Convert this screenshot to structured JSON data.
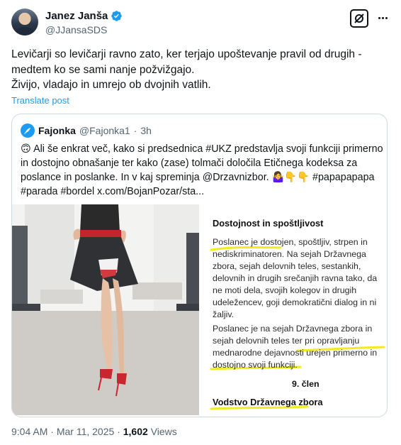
{
  "author": {
    "name": "Janez Janša",
    "handle": "@JJansaSDS"
  },
  "tweet": {
    "lines": [
      "Levičarji so levičarji ravno zato, ker terjajo upoštevanje pravil od drugih -",
      "medtem ko se sami nanje požvižgajo.",
      "Živijo, vladajo in umrejo ob dvojnih vatlih."
    ],
    "translate_label": "Translate post"
  },
  "quote": {
    "name": "Fajonka",
    "handle": "@Fajonka1",
    "separator": "·",
    "time": "3h",
    "lines": [
      "🙃 Ali še enkrat več, kako si predsednica #UKZ predstavlja svoji funkciji primerno",
      "in dostojno obnašanje ter kako (zase) tolmači določila Etičnega kodeksa za",
      "poslance in poslanke. In v kaj spreminja @Drzavnizbor. 🤷‍♀️👇👇 #papapapapa",
      "#parada #bordel  x.com/BojanPozar/sta..."
    ],
    "document": {
      "title": "Dostojnost in spoštljivost",
      "paragraph1": [
        "Poslanec je dostojen, spoštljiv, strpen in",
        "nediskriminatoren. Na sejah Državnega",
        "zbora, sejah delovnih teles, sestankih,",
        "delovnih in drugih srečanjih ravna tako, da",
        "ne moti dela,  svojih kolegov in drugih",
        "udeležencev, goji demokratični dialog in ni",
        "žaljiv."
      ],
      "paragraph2": [
        "Poslanec je na sejah Državnega zbora in",
        "sejah delovnih teles ter pri opravljanju",
        "mednarodne dejavnosti urejen primerno in",
        "dostojno svoji funkciji."
      ],
      "article": "9. člen",
      "footer_heading": "Vodstvo Državnega zbora"
    }
  },
  "meta": {
    "time": "9:04 AM",
    "separator": "·",
    "date": "Mar 11, 2025",
    "views_count": "1,602",
    "views_label": "Views"
  },
  "colors": {
    "accent": "#1d9bf0",
    "highlight": "#f2ea22",
    "secondary_text": "#536471",
    "border": "#cfd9de"
  }
}
